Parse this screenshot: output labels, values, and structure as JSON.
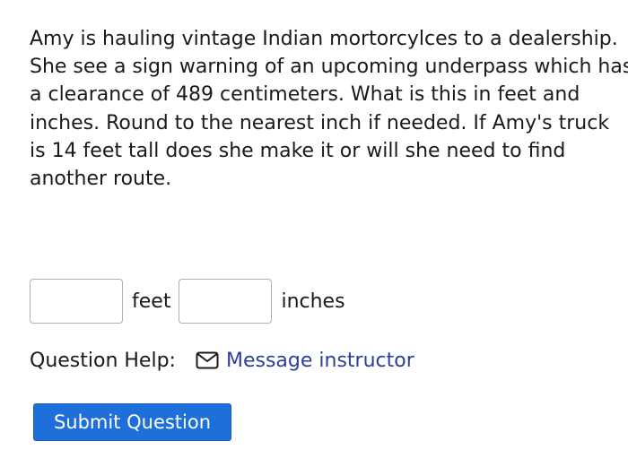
{
  "question": {
    "lines": [
      "Amy is hauling vintage Indian mortorcylces to a dealership.",
      "She see a sign warning of an upcoming underpass which has",
      "a clearance of 489 centimeters. What is this in feet and",
      "inches. Round to the nearest inch if needed. If Amy's truck",
      "is 14 feet tall does she make it or will she need to find",
      "another route."
    ]
  },
  "answer": {
    "feet_value": "",
    "feet_unit": "feet",
    "inches_value": "",
    "inches_unit": "inches"
  },
  "help": {
    "label": "Question Help:",
    "icon": "envelope-icon",
    "message_link": "Message instructor"
  },
  "submit": {
    "label": "Submit Question"
  },
  "colors": {
    "link": "#2b3f9a",
    "submit_bg": "#1e6fd9",
    "submit_text": "#ffffff"
  }
}
